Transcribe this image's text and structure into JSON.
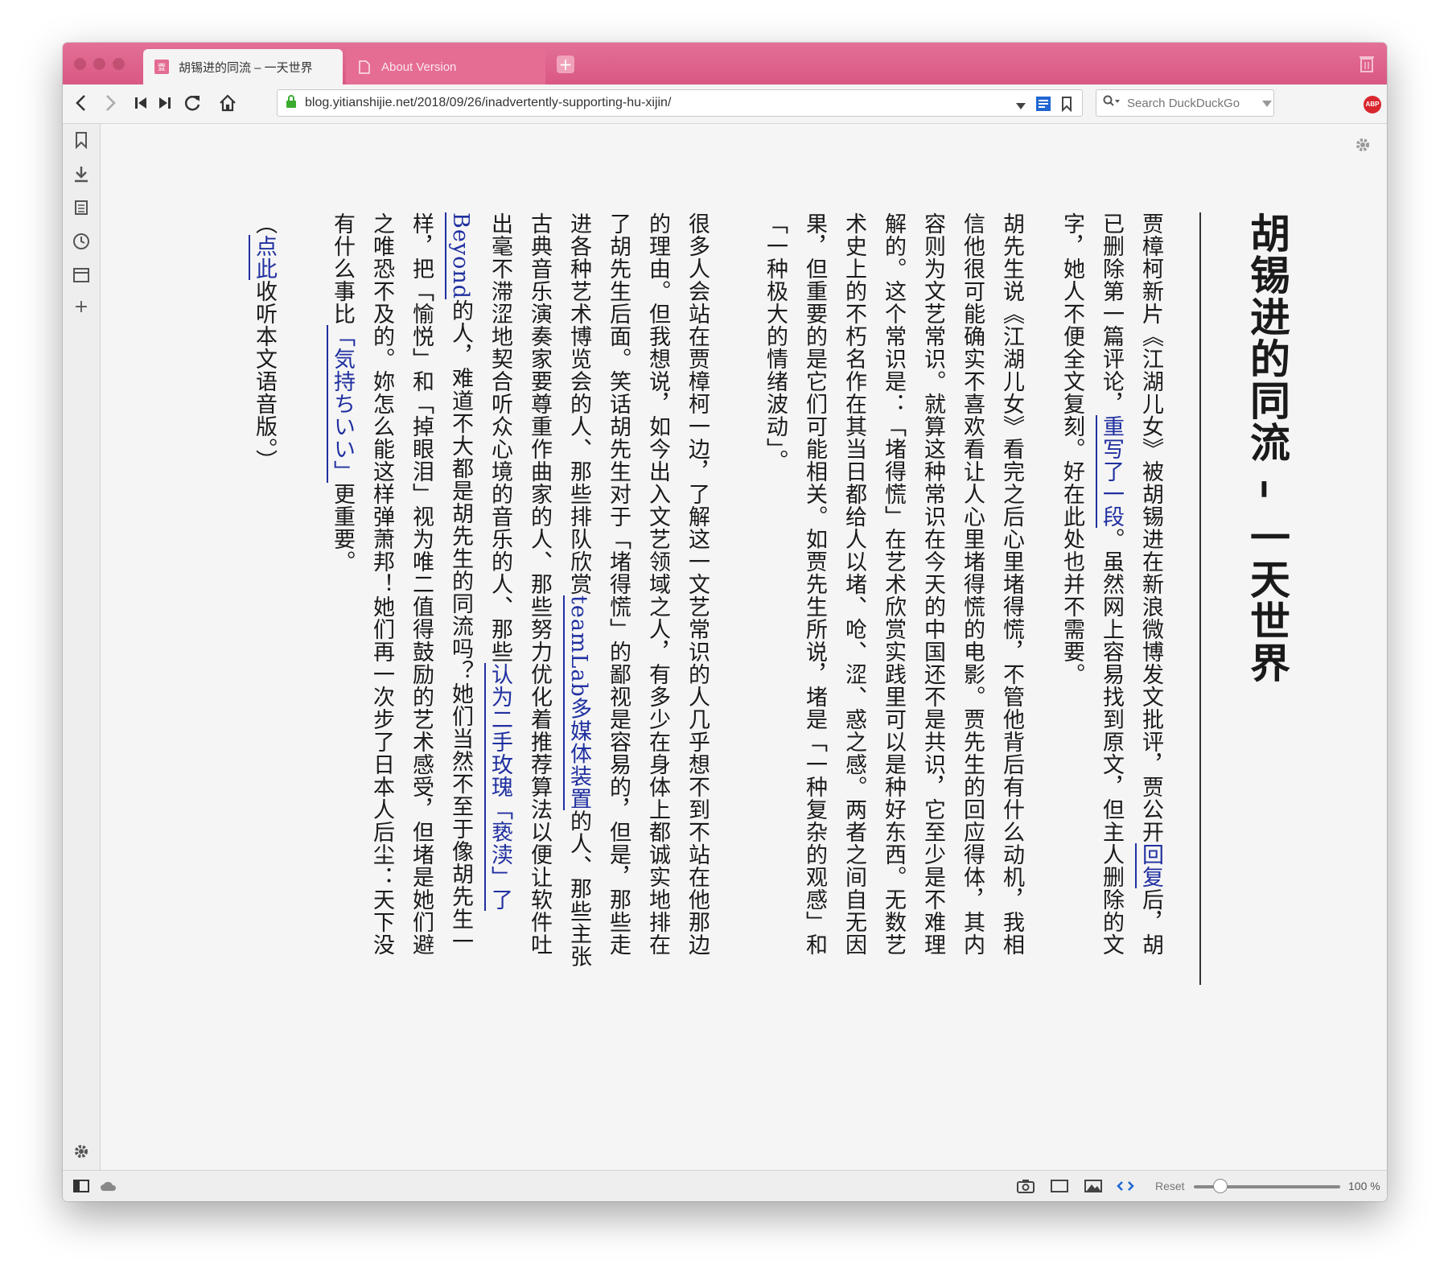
{
  "tabs": [
    {
      "title": "胡锡进的同流 – 一天世界",
      "active": true
    },
    {
      "title": "About Version",
      "active": false
    }
  ],
  "address": {
    "url": "blog.yitianshijie.net/2018/09/26/inadvertently-supporting-hu-xijin/"
  },
  "search": {
    "placeholder": "Search DuckDuckGo"
  },
  "extension": {
    "abp_label": "ABP"
  },
  "article": {
    "title": "胡锡进的同流 – 一天世界",
    "p1": {
      "a": "贾樟柯新片《江湖儿女》被胡锡进在新浪微博发文批评，贾公开",
      "link1": "回复",
      "b": "后，胡已删除第一篇评论，",
      "link2": "重写了一段",
      "c": "。虽然网上容易找到原文，但主人删除的文字，她人不便全文复刻。好在此处也并不需要。"
    },
    "p2": "胡先生说《江湖儿女》看完之后心里堵得慌，不管他背后有什么动机，我相信他很可能确实不喜欢看让人心里堵得慌的电影。贾先生的回应得体，其内容则为文艺常识。就算这种常识在今天的中国还不是共识，它至少是不难理解的。这个常识是：「堵得慌」在艺术欣赏实践里可以是种好东西。无数艺术史上的不朽名作在其当日都给人以堵、呛、涩、惑之感。两者之间自无因果，但重要的是它们可能相关。如贾先生所说，堵是「一种复杂的观感」和「一种极大的情绪波动」。",
    "p3": {
      "a": "很多人会站在贾樟柯一边，了解这一文艺常识的人几乎想不到不站在他那边的理由。但我想说，如今出入文艺领域之人，有多少在身体上都诚实地排在了胡先生后面。笑话胡先生对于「堵得慌」的鄙视是容易的，但是，那些走进各种艺术博览会的人、那些排队欣赏",
      "link1": "teamLab多媒体装置",
      "b": "的人、那些主张古典音乐演奏家要尊重作曲家的人、那些努力优化着推荐算法以便让软件吐出毫不滞涩地契合听众心境的音乐的人、那些",
      "link2": "认为二手玫瑰「亵渎」了Beyond",
      "c": "的人，难道不大都是胡先生的同流吗？她们当然不至于像胡先生一样，把「愉悦」和「掉眼泪」视为唯二值得鼓励的艺术感受，但堵是她们避之唯恐不及的。妳怎么能这样弹萧邦！她们再一次步了日本人后尘：天下没有什么事比",
      "link3": "「気持ちいい」",
      "d": "更重要。"
    },
    "audio": {
      "open": "（",
      "link": "点此",
      "rest": "收听本文语音版。）"
    }
  },
  "statusbar": {
    "reset": "Reset",
    "zoom": "100 %",
    "zoom_level": 0.15
  }
}
